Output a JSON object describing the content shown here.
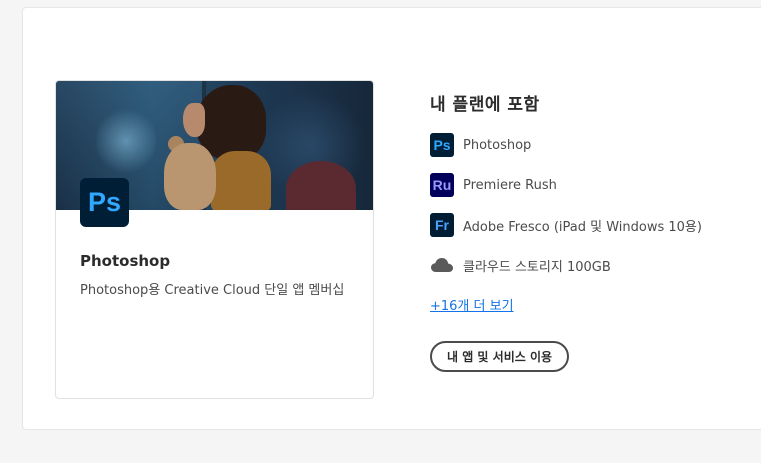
{
  "card": {
    "app_abbrev": "Ps",
    "title": "Photoshop",
    "description": "Photoshop용 Creative Cloud 단일 앱 멤버십"
  },
  "plan": {
    "title": "내 플랜에 포함",
    "items": [
      {
        "abbrev": "Ps",
        "label": "Photoshop",
        "bg": "#001e36",
        "fg": "#31a8ff",
        "icon": "photoshop-icon"
      },
      {
        "abbrev": "Ru",
        "label": "Premiere Rush",
        "bg": "#00005b",
        "fg": "#9999ff",
        "icon": "premiere-rush-icon"
      },
      {
        "abbrev": "Fr",
        "label": "Adobe Fresco (iPad 및 Windows 10용)",
        "bg": "#001d33",
        "fg": "#4ba3ff",
        "icon": "fresco-icon"
      },
      {
        "label": "클라우드 스토리지 100GB",
        "icon": "cloud-icon"
      }
    ],
    "more_link": "+16개 더 보기",
    "apps_button": "내 앱 및 서비스 이용"
  },
  "colors": {
    "link": "#1473e6",
    "ps_bg": "#001e36",
    "ps_fg": "#31a8ff"
  }
}
